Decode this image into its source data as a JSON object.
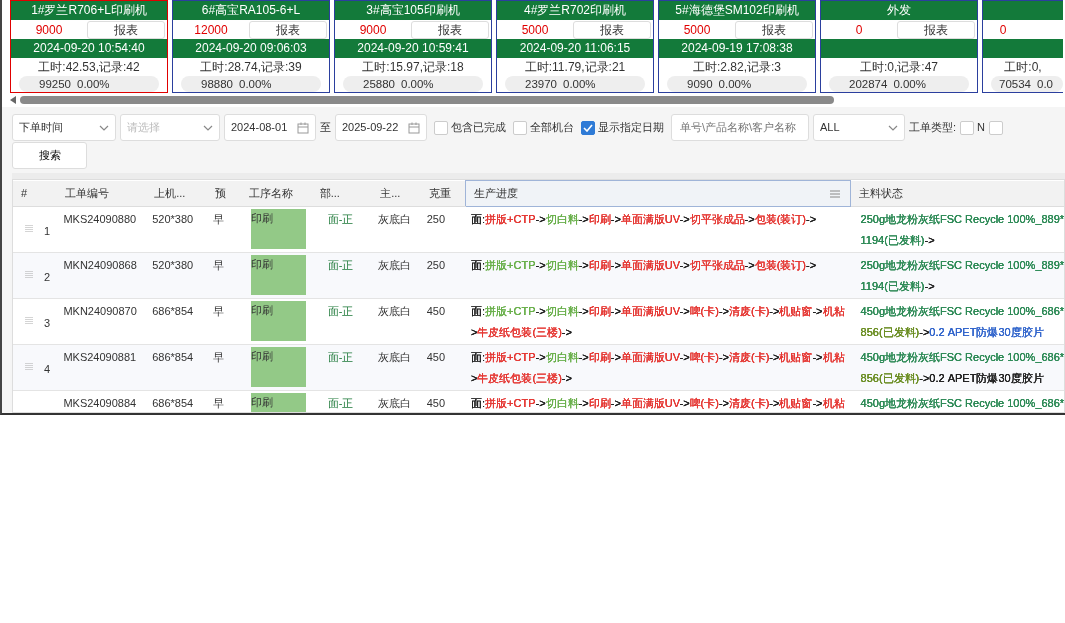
{
  "machines": [
    {
      "title": "1#罗兰R706+L印刷机",
      "target": "9000",
      "button": "报表",
      "time": "2024-09-20 10:54:40",
      "stats": "工时:42.53,记录:42",
      "count": "99250",
      "percent": "0.00%",
      "selected": true
    },
    {
      "title": "6#高宝RA105-6+L",
      "target": "12000",
      "button": "报表",
      "time": "2024-09-20 09:06:03",
      "stats": "工时:28.74,记录:39",
      "count": "98880",
      "percent": "0.00%",
      "selected": false
    },
    {
      "title": "3#高宝105印刷机",
      "target": "9000",
      "button": "报表",
      "time": "2024-09-20 10:59:41",
      "stats": "工时:15.97,记录:18",
      "count": "25880",
      "percent": "0.00%",
      "selected": false
    },
    {
      "title": "4#罗兰R702印刷机",
      "target": "5000",
      "button": "报表",
      "time": "2024-09-20 11:06:15",
      "stats": "工时:11.79,记录:21",
      "count": "23970",
      "percent": "0.00%",
      "selected": false
    },
    {
      "title": "5#海德堡SM102印刷机",
      "target": "5000",
      "button": "报表",
      "time": "2024-09-19 17:08:38",
      "stats": "工时:2.82,记录:3",
      "count": "9090",
      "percent": "0.00%",
      "selected": false
    },
    {
      "title": "外发",
      "target": "0",
      "button": "报表",
      "stats": "工时:0,记录:47",
      "count": "202874",
      "percent": "0.00%",
      "selected": false
    },
    {
      "target": "0",
      "stats": "工时:0,",
      "count": "70534",
      "percent": "0.0",
      "selected": false,
      "kind": "partial"
    }
  ],
  "filters": {
    "date_field": "下单时间",
    "category_placeholder": "请选择",
    "date_from": "2024-08-01",
    "range_separator": "至",
    "date_to": "2025-09-22",
    "checkboxes": [
      {
        "label": "包含已完成",
        "checked": false
      },
      {
        "label": "全部机台",
        "checked": false
      },
      {
        "label": "显示指定日期",
        "checked": true
      }
    ],
    "search_placeholder": "单号\\产品名称\\客户名称",
    "type_select": "ALL",
    "order_type_label": "工单类型:",
    "order_types": [
      {
        "label": "N",
        "checked": false
      },
      {
        "checked": false
      }
    ],
    "search_button": "搜索"
  },
  "table": {
    "columns": [
      "#",
      "工单编号",
      "上机...",
      "预",
      "工序名称",
      "部...",
      "主...",
      "克重",
      "生产进度",
      "主料状态"
    ],
    "rows": [
      {
        "index": "1",
        "order_no": "MKS24090880",
        "size": "520*380",
        "shift": "早",
        "process": "印刷",
        "part": "面-正",
        "main": "灰底白",
        "weight": "250",
        "progress": [
          [
            {
              "text": "面:",
              "color": "#222222"
            },
            {
              "text": "拼版+CTP",
              "color": "#e53935"
            },
            {
              "text": "->",
              "color": "#222222"
            },
            {
              "text": "切白料",
              "color": "#6ab04c"
            },
            {
              "text": "->",
              "color": "#222222"
            },
            {
              "text": "印刷",
              "color": "#e53935"
            },
            {
              "text": "->",
              "color": "#222222"
            },
            {
              "text": "单面满版UV",
              "color": "#e53935"
            },
            {
              "text": "->",
              "color": "#222222"
            },
            {
              "text": "切平张成品",
              "color": "#e53935"
            },
            {
              "text": "->",
              "color": "#222222"
            },
            {
              "text": "包装(装订)",
              "color": "#e53935"
            },
            {
              "text": "->",
              "color": "#222222"
            }
          ]
        ],
        "material": [
          [
            {
              "text": "250g地龙粉灰纸FSC Recycle 100%_889*",
              "color": "#2e8b57"
            }
          ],
          [
            {
              "text": "1194(已发料)",
              "color": "#2e8b57"
            },
            {
              "text": "->",
              "color": "#222222"
            }
          ]
        ]
      },
      {
        "index": "2",
        "order_no": "MKN24090868",
        "size": "520*380",
        "shift": "早",
        "process": "印刷",
        "part": "面-正",
        "main": "灰底白",
        "weight": "250",
        "progress": [
          [
            {
              "text": "面:",
              "color": "#222222"
            },
            {
              "text": "拼版+CTP",
              "color": "#6ab04c"
            },
            {
              "text": "->",
              "color": "#222222"
            },
            {
              "text": "切白料",
              "color": "#6ab04c"
            },
            {
              "text": "->",
              "color": "#222222"
            },
            {
              "text": "印刷",
              "color": "#e53935"
            },
            {
              "text": "->",
              "color": "#222222"
            },
            {
              "text": "单面满版UV",
              "color": "#e53935"
            },
            {
              "text": "->",
              "color": "#222222"
            },
            {
              "text": "切平张成品",
              "color": "#e53935"
            },
            {
              "text": "->",
              "color": "#222222"
            },
            {
              "text": "包装(装订)",
              "color": "#e53935"
            },
            {
              "text": "->",
              "color": "#222222"
            }
          ]
        ],
        "material": [
          [
            {
              "text": "250g地龙粉灰纸FSC Recycle 100%_889*",
              "color": "#2e8b57"
            }
          ],
          [
            {
              "text": "1194(已发料)",
              "color": "#2e8b57"
            },
            {
              "text": "->",
              "color": "#222222"
            }
          ]
        ]
      },
      {
        "index": "3",
        "order_no": "MKN24090870",
        "size": "686*854",
        "shift": "早",
        "process": "印刷",
        "part": "面-正",
        "main": "灰底白",
        "weight": "450",
        "progress": [
          [
            {
              "text": "面:",
              "color": "#222222"
            },
            {
              "text": "拼版+CTP",
              "color": "#6ab04c"
            },
            {
              "text": "->",
              "color": "#222222"
            },
            {
              "text": "切白料",
              "color": "#6ab04c"
            },
            {
              "text": "->",
              "color": "#222222"
            },
            {
              "text": "印刷",
              "color": "#e53935"
            },
            {
              "text": "->",
              "color": "#222222"
            },
            {
              "text": "单面满版UV",
              "color": "#e53935"
            },
            {
              "text": "->",
              "color": "#222222"
            },
            {
              "text": "啤(卡)",
              "color": "#e53935"
            },
            {
              "text": "->",
              "color": "#222222"
            },
            {
              "text": "清废(卡)",
              "color": "#e53935"
            },
            {
              "text": "->",
              "color": "#222222"
            },
            {
              "text": "机贴窗",
              "color": "#e53935"
            },
            {
              "text": "->",
              "color": "#222222"
            },
            {
              "text": "机粘",
              "color": "#e53935"
            }
          ],
          [
            {
              "text": ">",
              "color": "#222222"
            },
            {
              "text": "牛皮纸包装(三楼)",
              "color": "#e53935"
            },
            {
              "text": "->",
              "color": "#222222"
            }
          ]
        ],
        "material": [
          [
            {
              "text": "450g地龙粉灰纸FSC Recycle 100%_686*",
              "color": "#2e8b57"
            }
          ],
          [
            {
              "text": "856(已发料)",
              "color": "#6b8e23"
            },
            {
              "text": "->",
              "color": "#222222"
            },
            {
              "text": "0.2 APET防爆30度胶片",
              "color": "#3366cc"
            }
          ]
        ]
      },
      {
        "index": "4",
        "order_no": "MKS24090881",
        "size": "686*854",
        "shift": "早",
        "process": "印刷",
        "part": "面-正",
        "main": "灰底白",
        "weight": "450",
        "progress": [
          [
            {
              "text": "面:",
              "color": "#222222"
            },
            {
              "text": "拼版+CTP",
              "color": "#e53935"
            },
            {
              "text": "->",
              "color": "#222222"
            },
            {
              "text": "切白料",
              "color": "#6ab04c"
            },
            {
              "text": "->",
              "color": "#222222"
            },
            {
              "text": "印刷",
              "color": "#e53935"
            },
            {
              "text": "->",
              "color": "#222222"
            },
            {
              "text": "单面满版UV",
              "color": "#e53935"
            },
            {
              "text": "->",
              "color": "#222222"
            },
            {
              "text": "啤(卡)",
              "color": "#e53935"
            },
            {
              "text": "->",
              "color": "#222222"
            },
            {
              "text": "清废(卡)",
              "color": "#e53935"
            },
            {
              "text": "->",
              "color": "#222222"
            },
            {
              "text": "机贴窗",
              "color": "#e53935"
            },
            {
              "text": "->",
              "color": "#222222"
            },
            {
              "text": "机粘",
              "color": "#e53935"
            }
          ],
          [
            {
              "text": ">",
              "color": "#222222"
            },
            {
              "text": "牛皮纸包装(三楼)",
              "color": "#e53935"
            },
            {
              "text": "->",
              "color": "#222222"
            }
          ]
        ],
        "material": [
          [
            {
              "text": "450g地龙粉灰纸FSC Recycle 100%_686*",
              "color": "#2e8b57"
            }
          ],
          [
            {
              "text": "856(已发料)",
              "color": "#6b8e23"
            },
            {
              "text": "->",
              "color": "#222222"
            },
            {
              "text": "0.2 APET防爆30度胶片",
              "color": "#222222"
            }
          ]
        ]
      },
      {
        "order_no": "MKS24090884",
        "size": "686*854",
        "shift": "早",
        "process": "印刷",
        "part": "面-正",
        "main": "灰底白",
        "weight": "450",
        "progress": [
          [
            {
              "text": "面:",
              "color": "#222222"
            },
            {
              "text": "拼版+CTP",
              "color": "#e53935"
            },
            {
              "text": "->",
              "color": "#222222"
            },
            {
              "text": "切白料",
              "color": "#6ab04c"
            },
            {
              "text": "->",
              "color": "#222222"
            },
            {
              "text": "印刷",
              "color": "#e53935"
            },
            {
              "text": "->",
              "color": "#222222"
            },
            {
              "text": "单面满版UV",
              "color": "#e53935"
            },
            {
              "text": "->",
              "color": "#222222"
            },
            {
              "text": "啤(卡)",
              "color": "#e53935"
            },
            {
              "text": "->",
              "color": "#222222"
            },
            {
              "text": "清废(卡)",
              "color": "#e53935"
            },
            {
              "text": "->",
              "color": "#222222"
            },
            {
              "text": "机贴窗",
              "color": "#e53935"
            },
            {
              "text": "->",
              "color": "#222222"
            },
            {
              "text": "机粘",
              "color": "#e53935"
            }
          ]
        ],
        "material": [
          [
            {
              "text": "450g地龙粉灰纸FSC Recycle 100%_686*",
              "color": "#2e8b57"
            }
          ]
        ]
      }
    ]
  }
}
